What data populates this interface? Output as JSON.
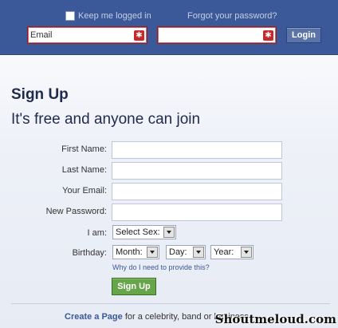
{
  "header": {
    "keep_logged_in_label": "Keep me logged in",
    "forgot_password_link": "Forgot your password?",
    "email_value": "Email",
    "password_value": "",
    "error_symbol": "✱",
    "login_button": "Login"
  },
  "signup": {
    "title": "Sign Up",
    "subtitle": "It's free and anyone can join",
    "first_name_label": "First Name:",
    "last_name_label": "Last Name:",
    "email_label": "Your Email:",
    "new_password_label": "New Password:",
    "sex_label": "I am:",
    "sex_select": "Select Sex:",
    "birthday_label": "Birthday:",
    "month_select": "Month:",
    "day_select": "Day:",
    "year_select": "Year:",
    "why_link": "Why do I need to provide this?",
    "signup_button": "Sign Up"
  },
  "footer": {
    "create_page_link": "Create a Page",
    "create_page_rest": " for a celebrity, band or business."
  },
  "watermark": "Shoutmeloud.com",
  "colors": {
    "brand_blue": "#3b5998",
    "signup_green": "#67a54b",
    "error_red": "#c72a2a"
  }
}
